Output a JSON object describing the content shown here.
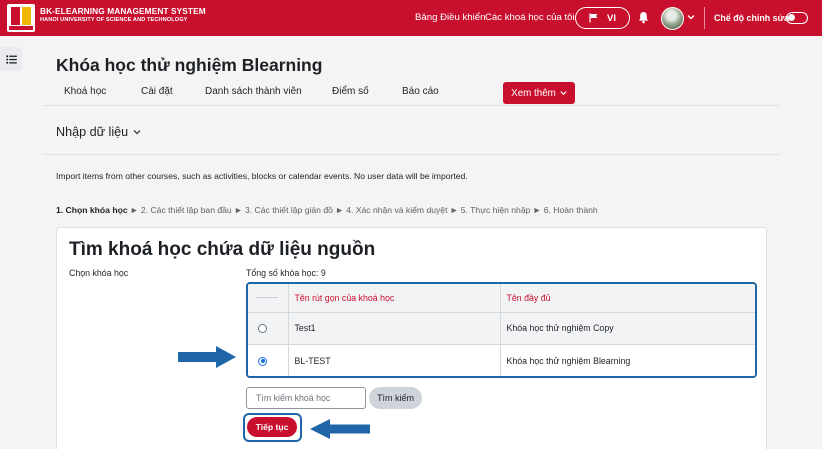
{
  "navbar": {
    "brand_title": "BK-ELEARNING MANAGEMENT SYSTEM",
    "brand_subtitle": "HANOI UNIVERSITY OF SCIENCE AND TECHNOLOGY",
    "dashboard_link": "Bảng Điều khiển",
    "my_courses_link": "Các khoá học của tôi",
    "language": "VI",
    "edit_mode_label": "Chế độ chỉnh sửa",
    "edit_mode_on": false
  },
  "drawer": {
    "icon": "list-icon"
  },
  "header": {
    "course_title": "Khóa học thử nghiệm Blearning",
    "tabs": [
      "Khoá học",
      "Cài đặt",
      "Danh sách thành viên",
      "Điểm số",
      "Báo cáo"
    ],
    "more_tab": "Xem thêm"
  },
  "import": {
    "section_title": "Nhập dữ liệu",
    "intro": "Import items from other courses, such as activities, blocks or calendar events. No user data will be imported.",
    "steps": {
      "current": "1. Chọn khóa học",
      "rest": [
        "2. Các thiết lập ban đầu",
        "3. Các thiết lập giản đồ",
        "4. Xác nhận và kiểm duyệt",
        "5. Thực hiện nhập",
        "6. Hoàn thành"
      ]
    }
  },
  "card": {
    "title": "Tìm khoá học chứa dữ liệu nguồn",
    "label": "Chọn khóa học",
    "total": "Tổng số khóa học: 9",
    "table": {
      "columns": [
        "",
        "Tên rút gọn của khoá học",
        "Tên đầy đủ"
      ],
      "rows": [
        {
          "shortname": "Test1",
          "fullname": "Khóa học thử nghiệm Copy",
          "selected": false
        },
        {
          "shortname": "BL-TEST",
          "fullname": "Khóa học thử nghiệm Blearning",
          "selected": true
        }
      ]
    },
    "search_placeholder": "Tìm kiếm khoá học",
    "search_button": "Tìm kiếm",
    "continue_button": "Tiếp tục"
  },
  "colors": {
    "brand_red": "#c8102e",
    "annotation_blue": "#1f66a8"
  }
}
